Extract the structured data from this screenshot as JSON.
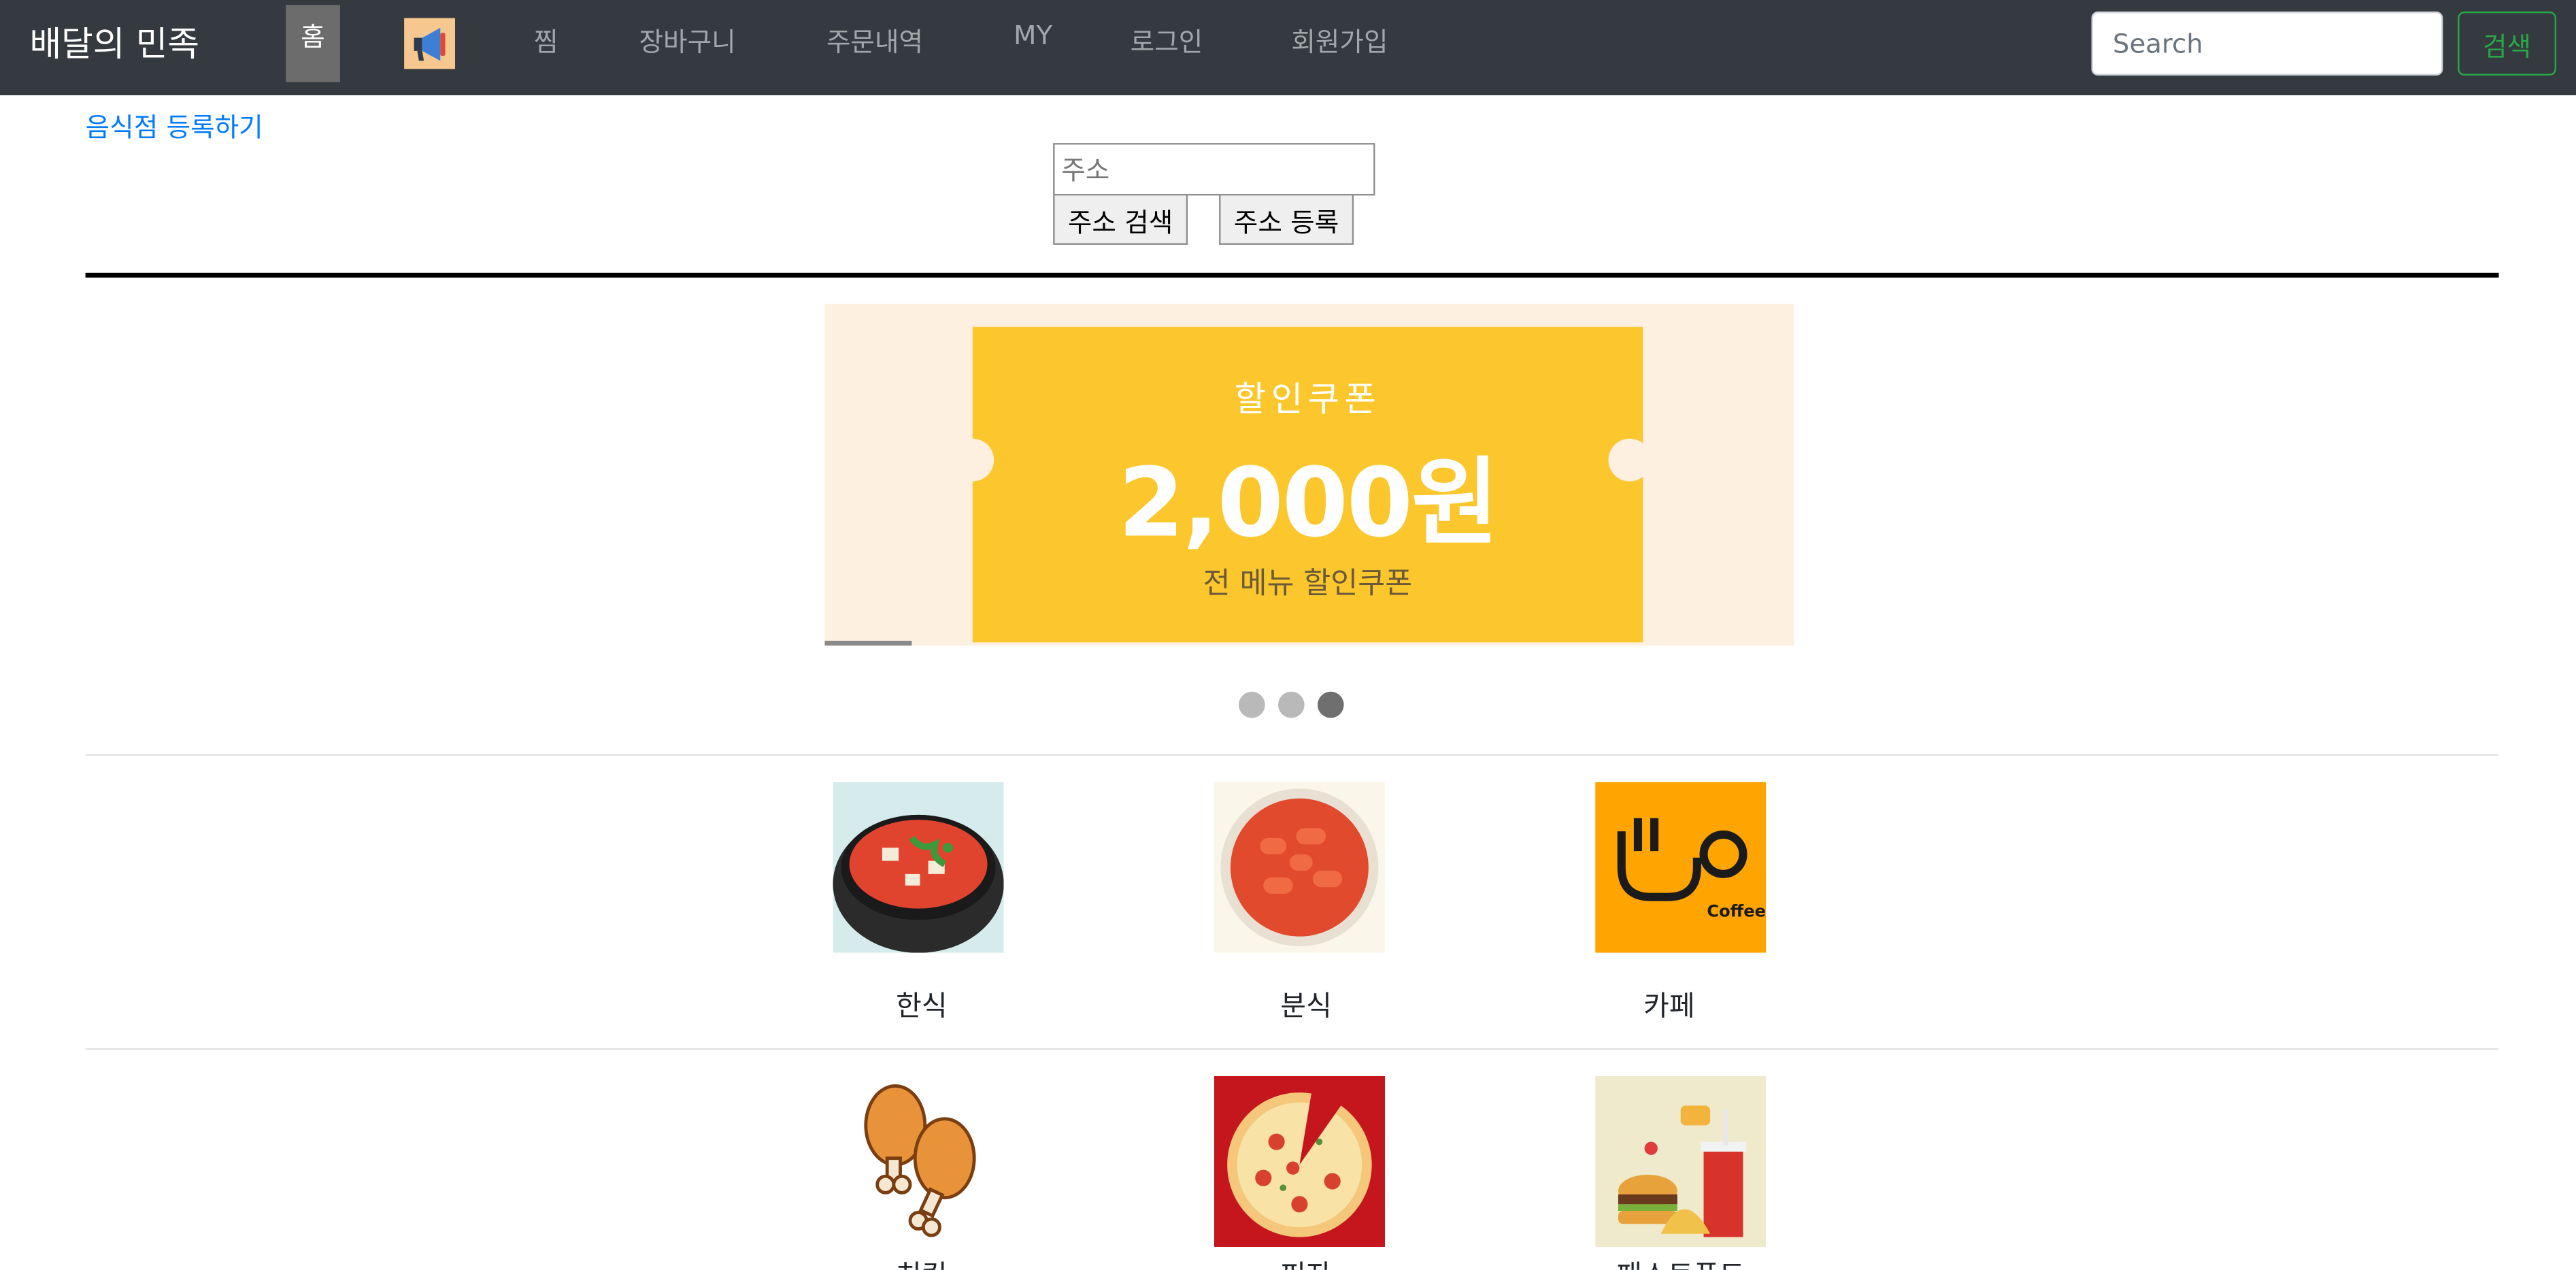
{
  "navbar": {
    "brand": "배달의 민족",
    "home": "홈",
    "links": [
      "찜",
      "장바구니",
      "주문내역",
      "MY",
      "로그인",
      "회원가입"
    ],
    "search_placeholder": "Search",
    "search_button": "검색"
  },
  "register_link": "음식점 등록하기",
  "address": {
    "placeholder": "주소",
    "search_button": "주소 검색",
    "register_button": "주소 등록"
  },
  "banner": {
    "title": "할인쿠폰",
    "amount": "2,000원",
    "subtitle": "전 메뉴 할인쿠폰",
    "slides": 3,
    "active_slide": 3
  },
  "categories": [
    {
      "label": "한식",
      "icon": "korean-food-icon"
    },
    {
      "label": "분식",
      "icon": "tteokbokki-icon"
    },
    {
      "label": "카페",
      "icon": "cafe-icon"
    },
    {
      "label": "치킨",
      "icon": "chicken-icon"
    },
    {
      "label": "피자",
      "icon": "pizza-icon"
    },
    {
      "label": "패스트푸드",
      "icon": "fastfood-icon"
    }
  ],
  "cafe_logo_text": "Coffee",
  "colors": {
    "navbar_bg": "#343a40",
    "link_blue": "#007bff",
    "search_green": "#28a745",
    "coupon_yellow": "#fcc62d"
  }
}
